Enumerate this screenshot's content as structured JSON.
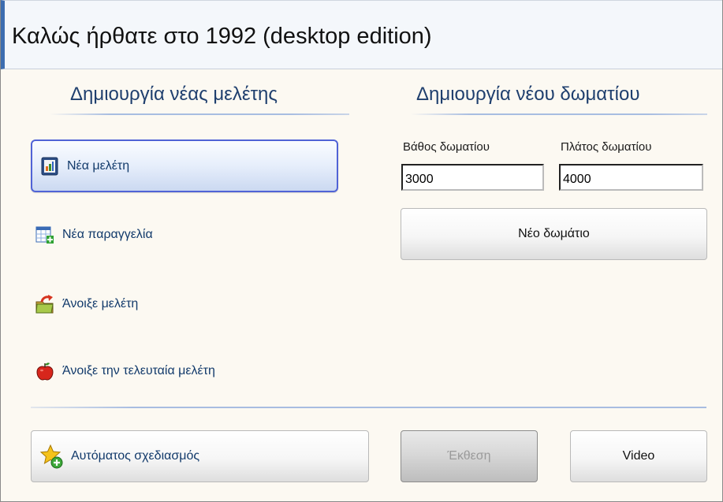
{
  "window": {
    "title": "Καλώς ήρθατε στο 1992 (desktop edition)"
  },
  "left_panel": {
    "heading": "Δημιουργία νέας μελέτης",
    "items": [
      {
        "label": "Νέα μελέτη",
        "icon": "document-chart-icon",
        "selected": true
      },
      {
        "label": "Νέα παραγγελία",
        "icon": "spreadsheet-add-icon",
        "selected": false
      },
      {
        "label": "Άνοιξε μελέτη",
        "icon": "folder-open-icon",
        "selected": false
      },
      {
        "label": "Άνοιξε την τελευταία μελέτη",
        "icon": "apple-icon",
        "selected": false
      }
    ]
  },
  "right_panel": {
    "heading": "Δημιουργία νέου δωματίου",
    "depth_label": "Βάθος δωματίου",
    "depth_value": "3000",
    "width_label": "Πλάτος δωματίου",
    "width_value": "4000",
    "new_room_button": "Νέο δωμάτιο"
  },
  "footer": {
    "auto_design_button": "Αυτόματος σχεδιασμός",
    "auto_design_icon": "star-add-icon",
    "exhibition_button": "Έκθεση",
    "exhibition_disabled": true,
    "video_button": "Video"
  },
  "colors": {
    "accent_border": "#5063d6",
    "heading_text": "#1f3f6e",
    "title_bar_stripe": "#3d6db0",
    "panel_background": "#fcf9f2"
  }
}
